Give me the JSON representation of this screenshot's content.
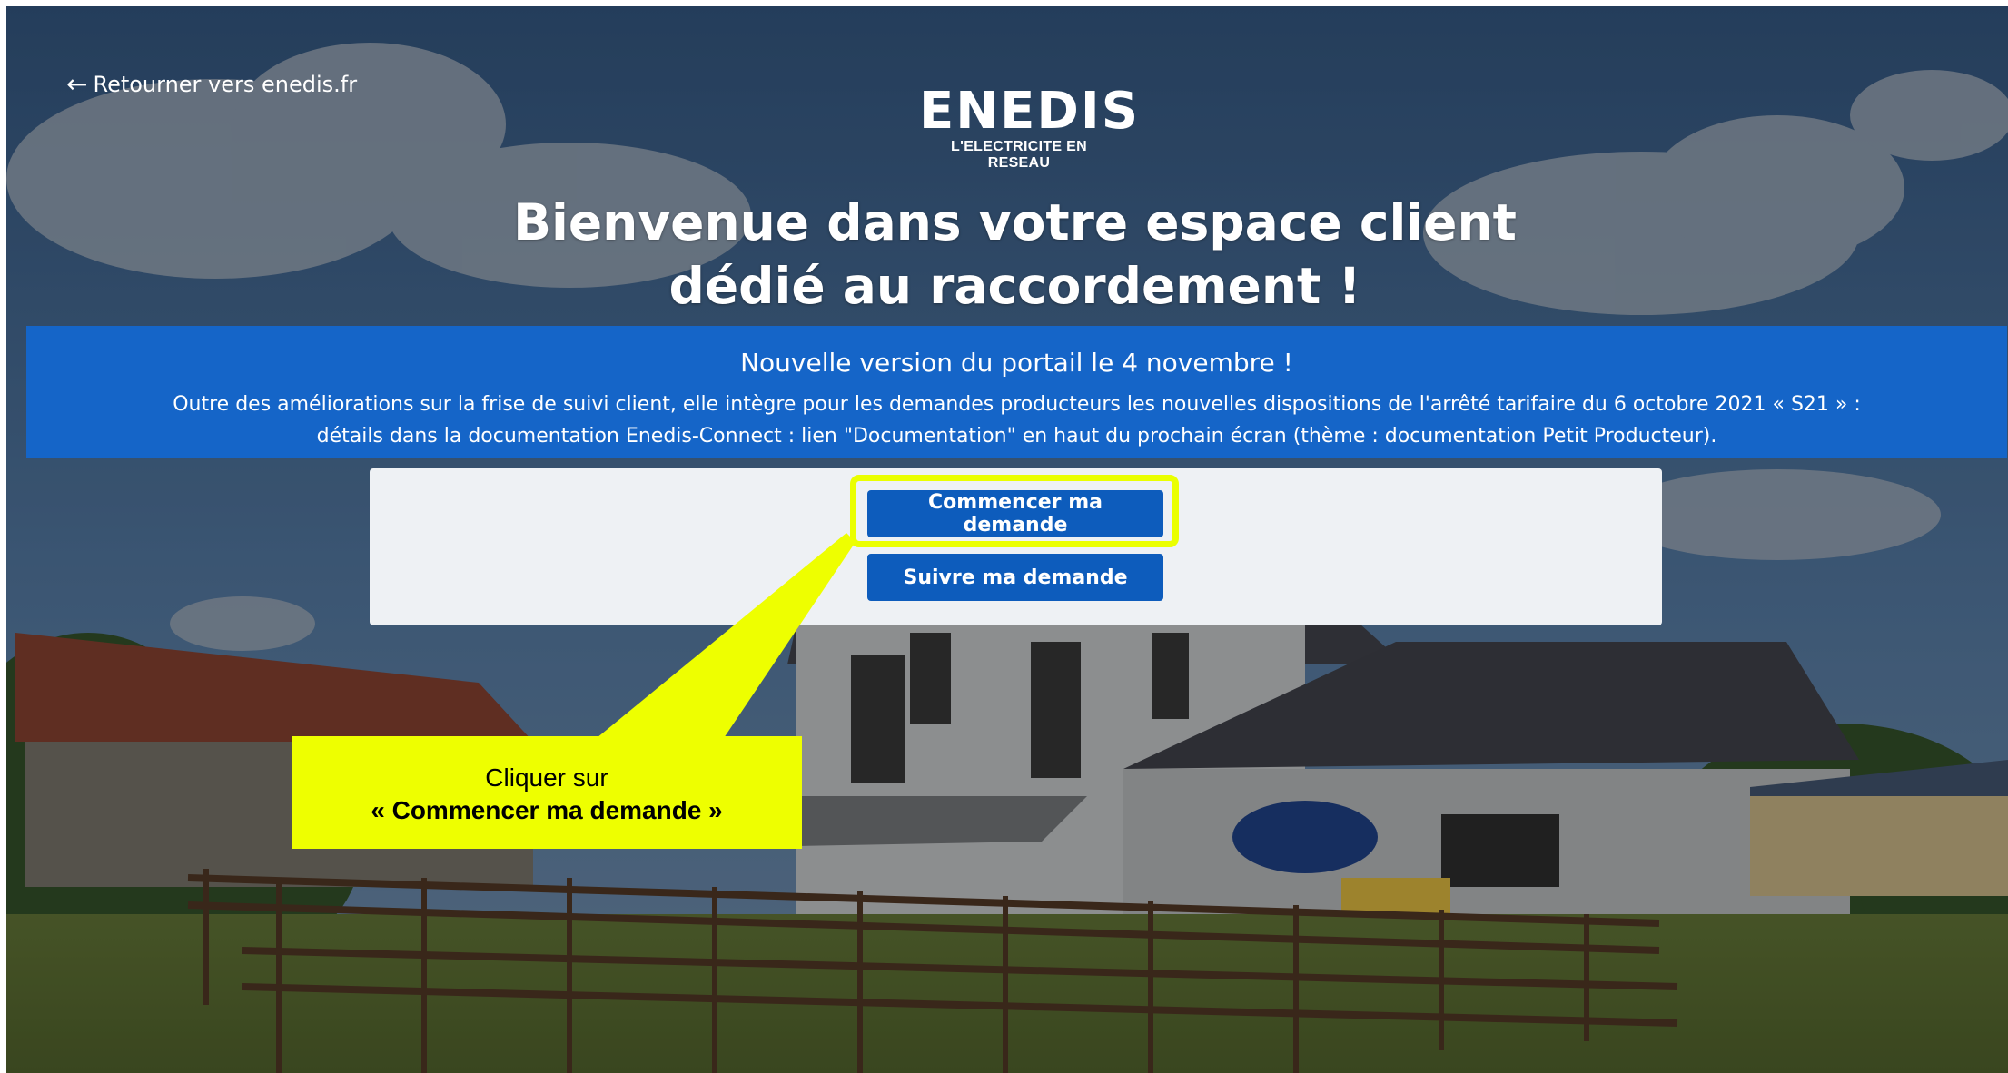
{
  "nav": {
    "back_arrow": "←",
    "back_label": "Retourner vers enedis.fr"
  },
  "logo": {
    "wordmark": "ENEDIS",
    "tagline": "L'ELECTRICITE EN RESEAU"
  },
  "hero": {
    "title_line1": "Bienvenue dans votre espace client",
    "title_line2": "dédié au raccordement !"
  },
  "banner": {
    "headline": "Nouvelle version du portail le 4 novembre !",
    "body_line1": "Outre des améliorations sur la frise de suivi client, elle intègre pour les demandes producteurs les nouvelles dispositions de l'arrêté tarifaire du 6 octobre 2021 « S21 » :",
    "body_line2": "détails dans la documentation Enedis-Connect : lien \"Documentation\" en haut du prochain écran (thème : documentation Petit Producteur)."
  },
  "actions": {
    "start_label": "Commencer ma demande",
    "follow_label": "Suivre ma demande"
  },
  "callout": {
    "line1": "Cliquer sur",
    "line2": "« Commencer ma demande »"
  },
  "colors": {
    "banner_blue": "#1565c8",
    "button_blue": "#0d5cbc",
    "highlight_yellow": "#eeff00",
    "card_bg": "#eef1f4"
  }
}
